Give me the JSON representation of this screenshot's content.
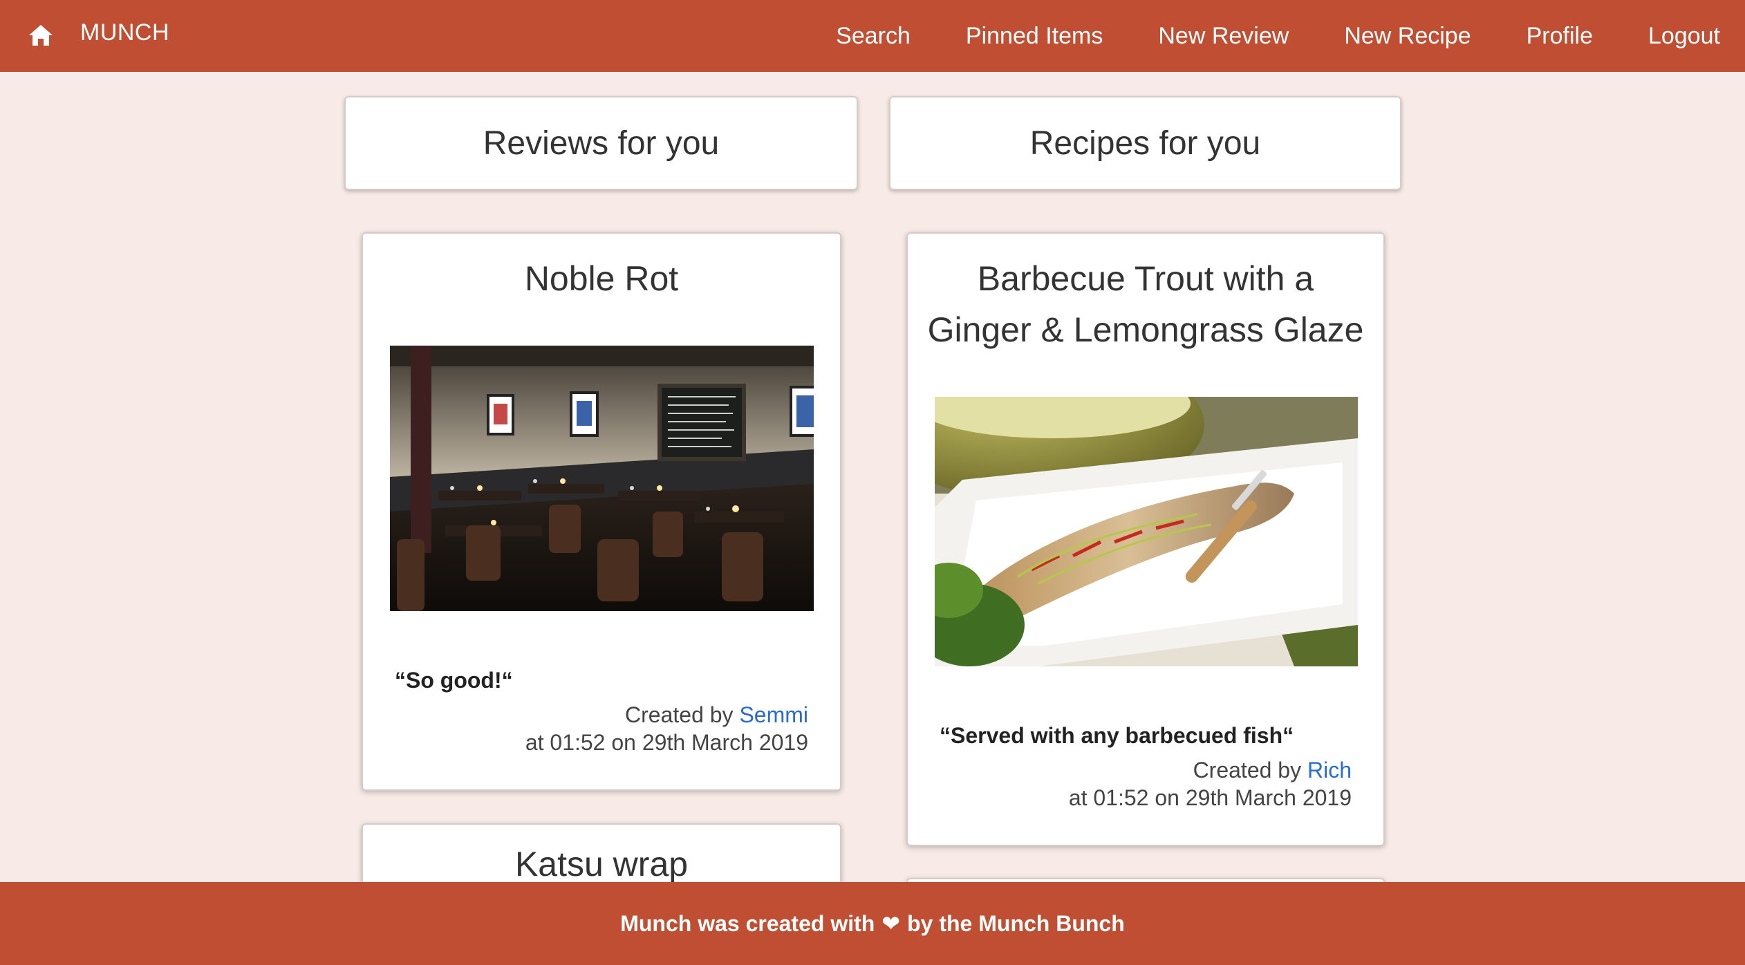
{
  "nav": {
    "home_icon": "home-icon",
    "brand": "MUNCH",
    "links": [
      "Search",
      "Pinned Items",
      "New Review",
      "New Recipe",
      "Profile",
      "Logout"
    ]
  },
  "sections": {
    "reviews_heading": "Reviews for you",
    "recipes_heading": "Recipes for you"
  },
  "reviews": [
    {
      "title": "Noble Rot",
      "image_desc": "restaurant-interior-photo",
      "quote": "“So good!“",
      "created_prefix": "Created by",
      "author": "Semmi",
      "timestamp": "at 01:52 on 29th March 2019"
    },
    {
      "title": "Katsu wrap"
    }
  ],
  "recipes": [
    {
      "title_line1": "Barbecue Trout with a",
      "title_line2": "Ginger & Lemongrass Glaze",
      "image_desc": "grilled-trout-photo",
      "quote": "“Served with any barbecued fish“",
      "created_prefix": "Created by",
      "author": "Rich",
      "timestamp": "at 01:52 on 29th March 2019"
    }
  ],
  "footer": {
    "text_before": "Munch was created with",
    "heart": "❤",
    "text_after": "by the Munch Bunch"
  },
  "colors": {
    "brand": "#c04e33",
    "background": "#f8ebe7",
    "link": "#2a6bd1"
  }
}
